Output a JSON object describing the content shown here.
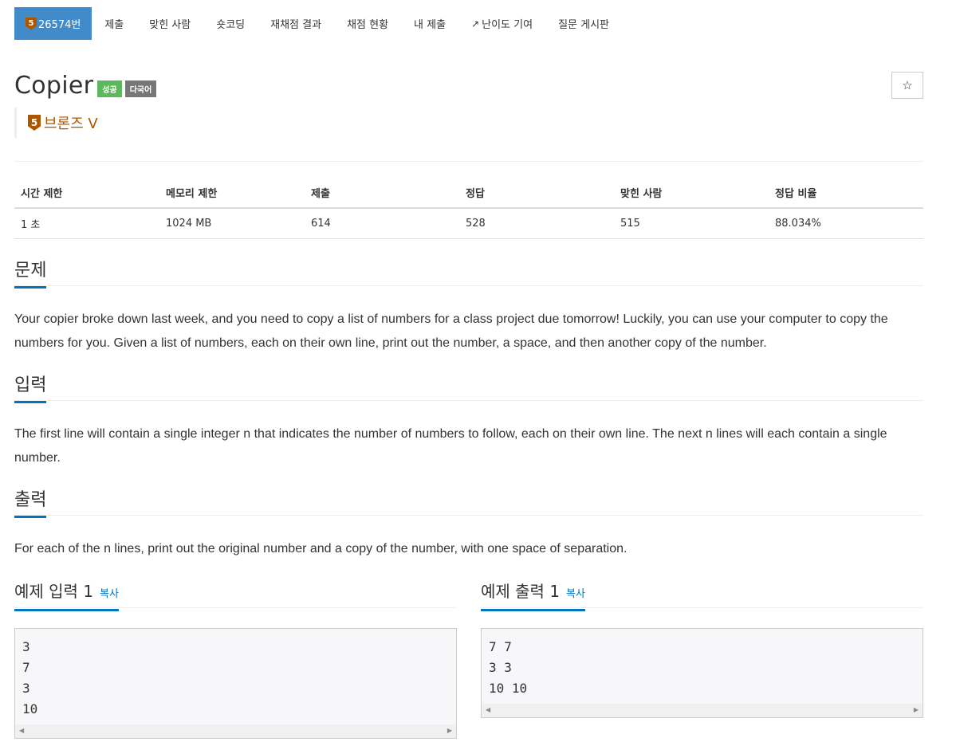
{
  "nav": {
    "items": [
      {
        "label": "26574번",
        "tier": "5",
        "active": true
      },
      {
        "label": "제출"
      },
      {
        "label": "맞힌 사람"
      },
      {
        "label": "숏코딩"
      },
      {
        "label": "재채점 결과"
      },
      {
        "label": "채점 현황"
      },
      {
        "label": "내 제출"
      },
      {
        "label": "난이도 기여",
        "icon": "external-link-icon"
      },
      {
        "label": "질문 게시판"
      }
    ]
  },
  "problem": {
    "title": "Copier",
    "labels": [
      "성공",
      "다국어"
    ],
    "tier_number": "5",
    "tier_name": "브론즈 V",
    "star_icon": "☆"
  },
  "info": {
    "headers": [
      "시간 제한",
      "메모리 제한",
      "제출",
      "정답",
      "맞힌 사람",
      "정답 비율"
    ],
    "values": [
      "1 초",
      "1024 MB",
      "614",
      "528",
      "515",
      "88.034%"
    ]
  },
  "sections": {
    "description": {
      "title": "문제",
      "text": "Your copier broke down last week, and you need to copy a list of numbers for a class project due tomorrow! Luckily, you can use your computer to copy the numbers for you. Given a list of numbers, each on their own line, print out the number, a space, and then another copy of the number."
    },
    "input": {
      "title": "입력",
      "text": "The first line will contain a single integer n that indicates the number of numbers to follow, each on their own line. The next n lines will each contain a single number."
    },
    "output": {
      "title": "출력",
      "text": "For each of the n lines, print out the original number and a copy of the number, with one space of separation."
    }
  },
  "samples": {
    "input_title": "예제 입력 1",
    "output_title": "예제 출력 1",
    "copy_label": "복사",
    "input_text": "3\n7\n3\n10",
    "output_text": "7 7\n3 3\n10 10"
  },
  "colors": {
    "nav_active": "#428bca",
    "bronze": "#ad5600",
    "success": "#5cb85c",
    "default_label": "#777777",
    "section_underline": "#0076c0"
  }
}
